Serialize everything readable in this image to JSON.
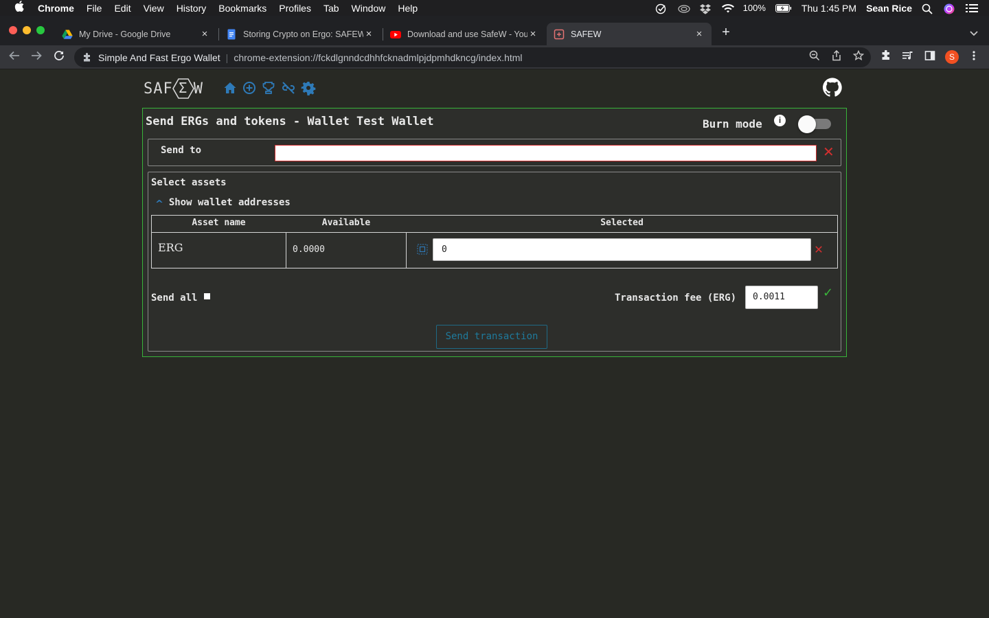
{
  "menubar": {
    "app": "Chrome",
    "items": [
      "File",
      "Edit",
      "View",
      "History",
      "Bookmarks",
      "Profiles",
      "Tab",
      "Window",
      "Help"
    ],
    "battery": "100%",
    "clock": "Thu 1:45 PM",
    "user": "Sean Rice"
  },
  "tabs": [
    {
      "title": "My Drive - Google Drive"
    },
    {
      "title": "Storing Crypto on Ergo: SAFEW"
    },
    {
      "title": "Download and use SafeW - YouTube"
    },
    {
      "title": "SAFEW"
    }
  ],
  "address": {
    "site": "Simple And Fast Ergo Wallet",
    "url": "chrome-extension://fckdlgnndcdhhfcknadmlpjdpmhdkncg/index.html"
  },
  "profile_initial": "S",
  "app": {
    "logo_left": "SAF",
    "logo_sigma": "Σ",
    "logo_right": "W",
    "nav_icons": [
      "home-icon",
      "add-circle-icon",
      "trophy-icon",
      "unlink-icon",
      "gear-icon"
    ],
    "accent": "#39b53a",
    "link_color": "#2e7ab8"
  },
  "panel": {
    "title": "Send ERGs and tokens - Wallet Test Wallet",
    "burn_mode_label": "Burn mode",
    "send_to_label": "Send to",
    "send_to_value": "",
    "select_assets_label": "Select assets",
    "show_addresses_label": "Show wallet addresses",
    "table": {
      "headers": [
        "Asset name",
        "Available",
        "Selected"
      ],
      "rows": [
        {
          "name": "ERG",
          "available": "0.0000",
          "selected": "0"
        }
      ]
    },
    "send_all_label": "Send all",
    "fee_label": "Transaction fee (ERG)",
    "fee_value": "0.0011",
    "send_button": "Send transaction"
  }
}
